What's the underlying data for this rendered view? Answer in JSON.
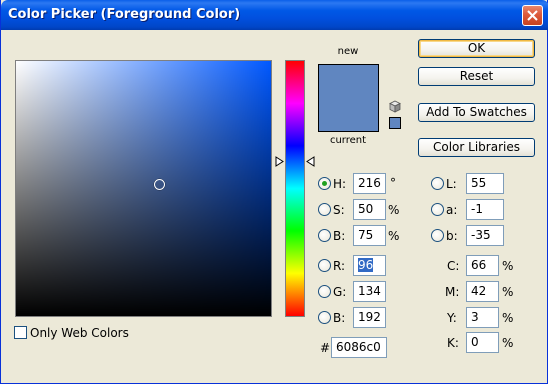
{
  "window": {
    "title": "Color Picker (Foreground Color)"
  },
  "swatch": {
    "new_label": "new",
    "current_label": "current",
    "new_color": "#6086c0",
    "current_color": "#6086c0"
  },
  "buttons": {
    "ok": "OK",
    "reset": "Reset",
    "add_to_swatches": "Add To Swatches",
    "color_libraries": "Color Libraries"
  },
  "hsb": {
    "h": {
      "label": "H:",
      "value": "216",
      "unit": "°",
      "checked": true
    },
    "s": {
      "label": "S:",
      "value": "50",
      "unit": "%"
    },
    "b": {
      "label": "B:",
      "value": "75",
      "unit": "%"
    }
  },
  "rgb": {
    "r": {
      "label": "R:",
      "value": "96"
    },
    "g": {
      "label": "G:",
      "value": "134"
    },
    "b": {
      "label": "B:",
      "value": "192"
    }
  },
  "lab": {
    "l": {
      "label": "L:",
      "value": "55"
    },
    "a": {
      "label": "a:",
      "value": "-1"
    },
    "b": {
      "label": "b:",
      "value": "-35"
    }
  },
  "cmyk": {
    "c": {
      "label": "C:",
      "value": "66",
      "unit": "%"
    },
    "m": {
      "label": "M:",
      "value": "42",
      "unit": "%"
    },
    "y": {
      "label": "Y:",
      "value": "3",
      "unit": "%"
    },
    "k": {
      "label": "K:",
      "value": "0",
      "unit": "%"
    }
  },
  "hex": {
    "label": "#",
    "value": "6086c0"
  },
  "web_colors": {
    "label": "Only Web Colors",
    "checked": false
  },
  "colors": {
    "hue_color": "#0058ff",
    "title_bar": "#0054e3",
    "selection": "#316ac5"
  }
}
